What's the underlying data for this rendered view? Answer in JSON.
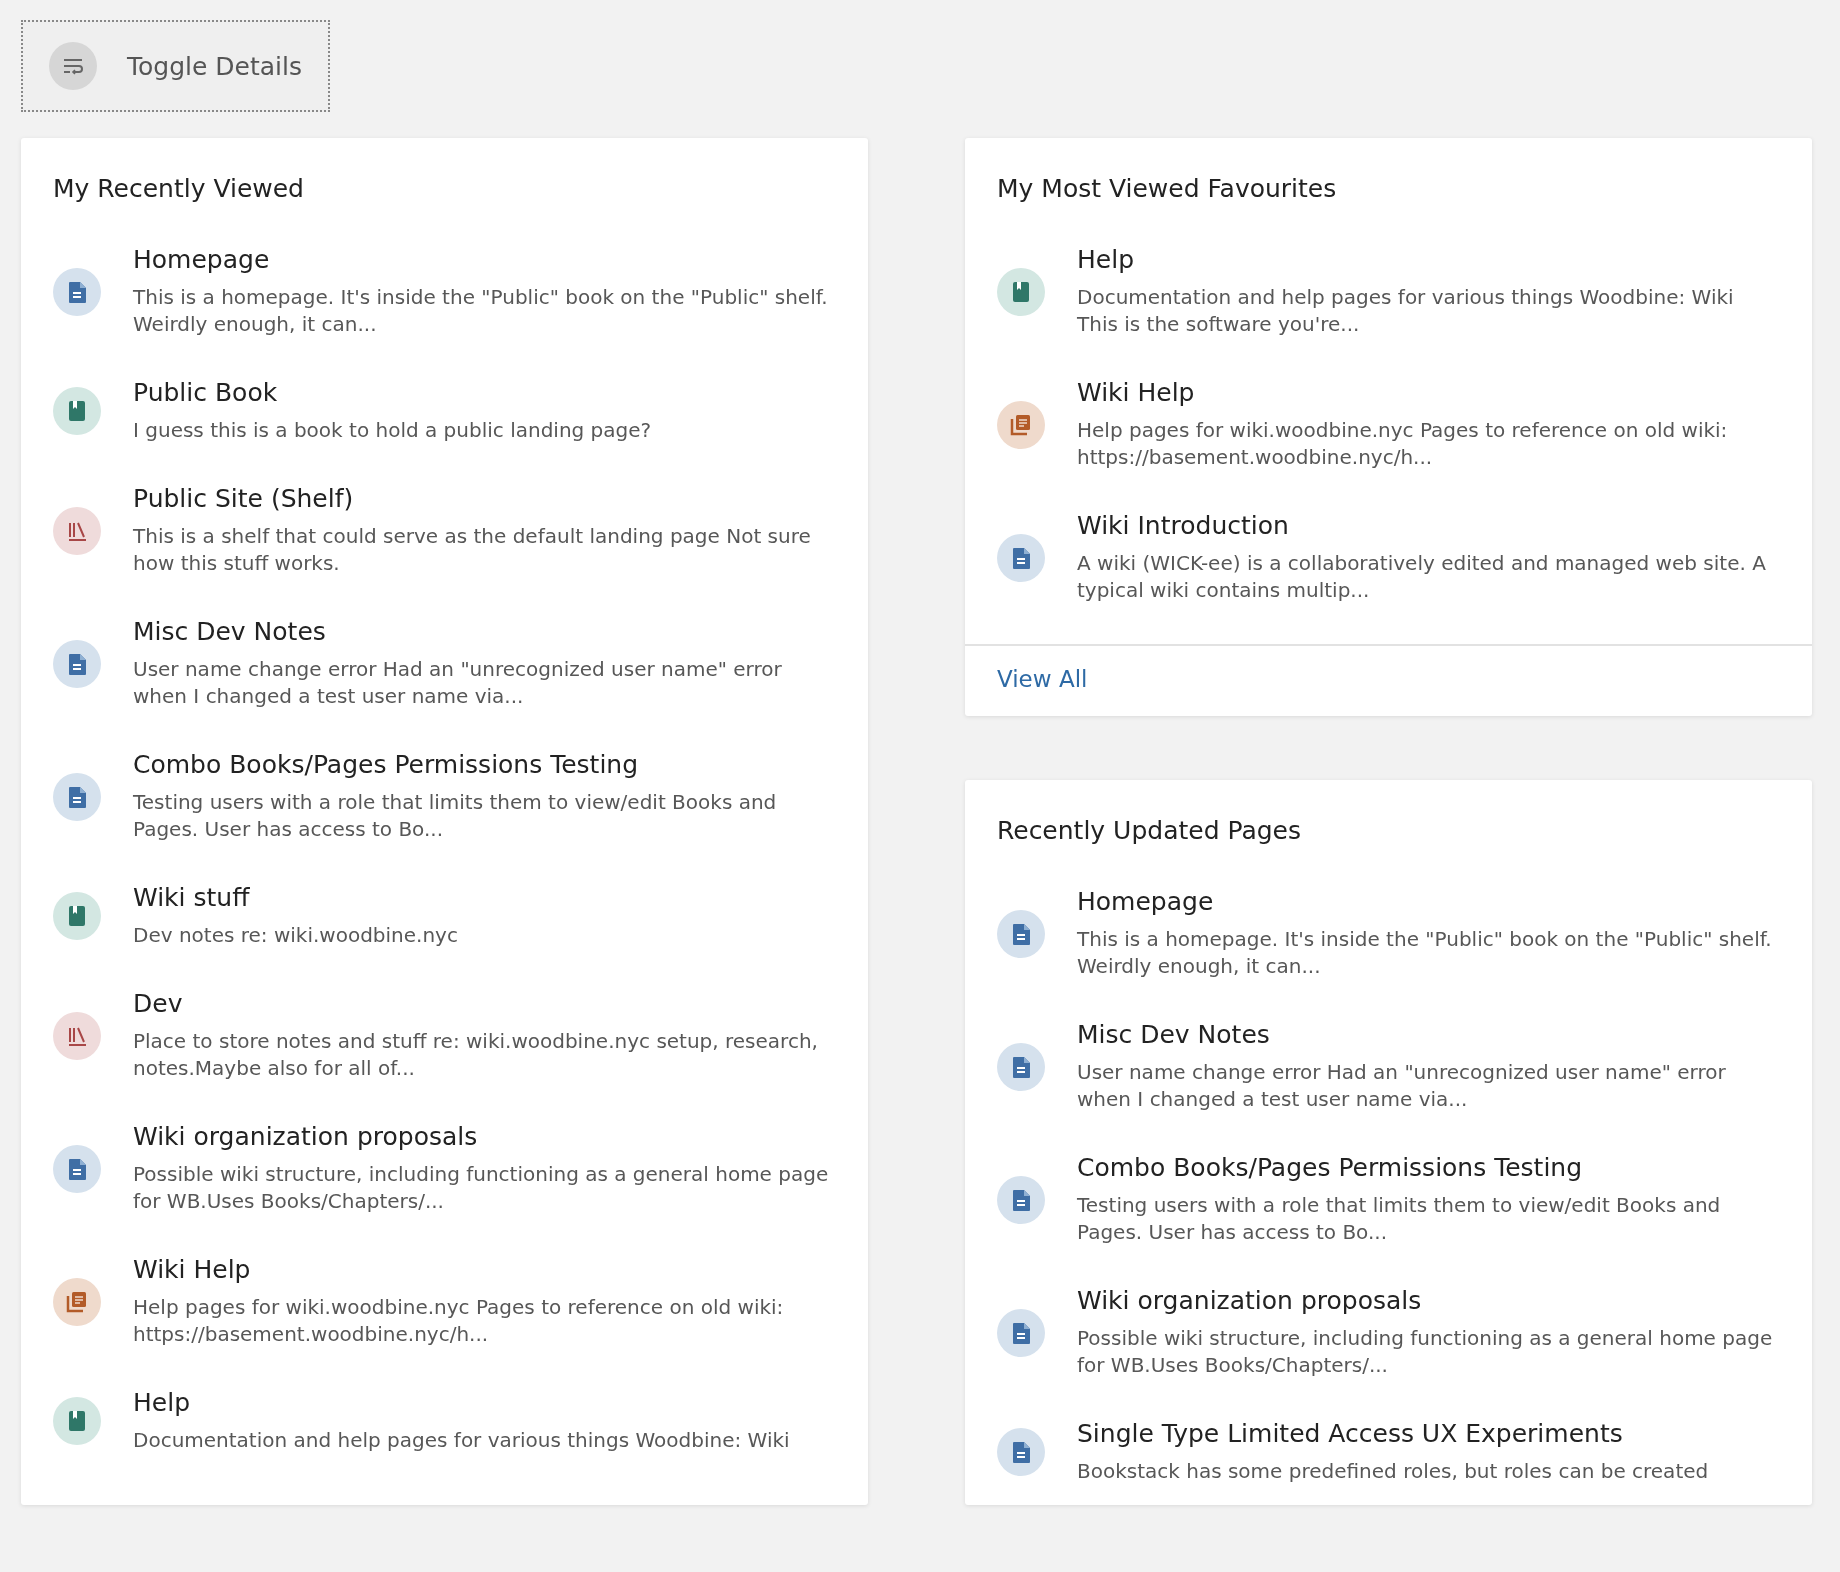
{
  "toggle_button": {
    "label": "Toggle Details"
  },
  "recently_viewed": {
    "title": "My Recently Viewed",
    "items": [
      {
        "kind": "page",
        "title": "Homepage",
        "description": "This is a homepage. It's inside the \"Public\" book on the \"Public\" shelf. Weirdly enough, it can..."
      },
      {
        "kind": "book",
        "title": "Public Book",
        "description": "I guess this is a book to hold a public landing page?"
      },
      {
        "kind": "shelf",
        "title": "Public Site (Shelf)",
        "description": "This is a shelf that could serve as the default landing page Not sure how this stuff works."
      },
      {
        "kind": "page",
        "title": "Misc Dev Notes",
        "description": "User name change error Had an \"unrecognized user name\" error when I changed a test user name via..."
      },
      {
        "kind": "page",
        "title": "Combo Books/Pages Permissions Testing",
        "description": "Testing users with a role that limits them to view/edit Books and Pages. User has access to Bo..."
      },
      {
        "kind": "book",
        "title": "Wiki stuff",
        "description": "Dev notes re: wiki.woodbine.nyc"
      },
      {
        "kind": "shelf",
        "title": "Dev",
        "description": "Place to store notes and stuff re: wiki.woodbine.nyc setup, research, notes.Maybe also for all of..."
      },
      {
        "kind": "page",
        "title": "Wiki organization proposals",
        "description": "Possible wiki structure, including functioning as a general home page for WB.Uses Books/Chapters/..."
      },
      {
        "kind": "chapter",
        "title": "Wiki Help",
        "description": "Help pages for wiki.woodbine.nyc Pages to reference on old wiki: https://basement.woodbine.nyc/h..."
      },
      {
        "kind": "book",
        "title": "Help",
        "description": "Documentation and help pages for various things Woodbine:  Wiki"
      }
    ]
  },
  "most_viewed_favourites": {
    "title": "My Most Viewed Favourites",
    "items": [
      {
        "kind": "book",
        "title": "Help",
        "description": "Documentation and help pages for various things Woodbine:  Wiki This is the software you're..."
      },
      {
        "kind": "chapter",
        "title": "Wiki Help",
        "description": "Help pages for wiki.woodbine.nyc Pages to reference on old wiki: https://basement.woodbine.nyc/h..."
      },
      {
        "kind": "page",
        "title": "Wiki Introduction",
        "description": "A wiki (WICK-ee) is a collaboratively edited and managed web site. A typical wiki contains multip..."
      }
    ],
    "view_all": "View All"
  },
  "recently_updated_pages": {
    "title": "Recently Updated Pages",
    "items": [
      {
        "kind": "page",
        "title": "Homepage",
        "description": "This is a homepage. It's inside the \"Public\" book on the \"Public\" shelf. Weirdly enough, it can..."
      },
      {
        "kind": "page",
        "title": "Misc Dev Notes",
        "description": "User name change error Had an \"unrecognized user name\" error when I changed a test user name via..."
      },
      {
        "kind": "page",
        "title": "Combo Books/Pages Permissions Testing",
        "description": "Testing users with a role that limits them to view/edit Books and Pages. User has access to Bo..."
      },
      {
        "kind": "page",
        "title": "Wiki organization proposals",
        "description": "Possible wiki structure, including functioning as a general home page for WB.Uses Books/Chapters/..."
      },
      {
        "kind": "page",
        "title": "Single Type Limited Access UX Experiments",
        "description": "Bookstack has some predefined roles, but roles can be created"
      }
    ]
  }
}
